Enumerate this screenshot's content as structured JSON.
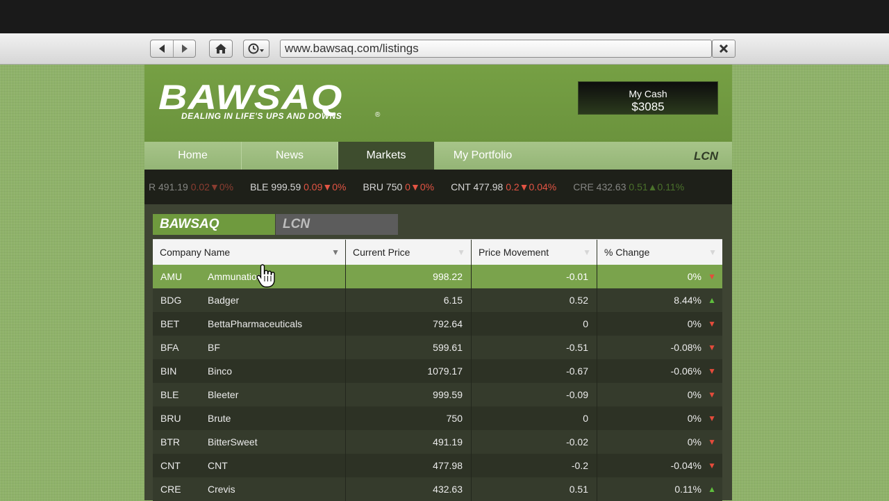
{
  "browser": {
    "url": "www.bawsaq.com/listings",
    "back_icon": "arrow-left-icon",
    "forward_icon": "arrow-right-icon",
    "home_icon": "home-icon",
    "history_icon": "clock-icon",
    "close_icon": "close-icon"
  },
  "header": {
    "logo": "BAWSAQ",
    "tagline": "DEALING IN LIFE'S UPS AND DOWNS",
    "registered": "®",
    "cash_label": "My Cash",
    "cash_value": "$3085"
  },
  "nav": {
    "tabs": [
      {
        "label": "Home"
      },
      {
        "label": "News"
      },
      {
        "label": "Markets",
        "active": true
      },
      {
        "label": "My Portfolio"
      }
    ],
    "lcn_logo": "LCN"
  },
  "ticker": [
    {
      "sym": "R 491.19",
      "chg": "0.02",
      "pct": "0%",
      "dir": "down",
      "faded": true
    },
    {
      "sym": "BLE 999.59",
      "chg": "0.09",
      "pct": "0%",
      "dir": "down"
    },
    {
      "sym": "BRU 750",
      "chg": "0",
      "pct": "0%",
      "dir": "down"
    },
    {
      "sym": "CNT 477.98",
      "chg": "0.2",
      "pct": "0.04%",
      "dir": "down"
    },
    {
      "sym": "CRE 432.63",
      "chg": "0.51",
      "pct": "0.11%",
      "dir": "up",
      "faded": true
    }
  ],
  "market_tabs": {
    "bawsaq": "BAWSAQ",
    "lcn": "LCN"
  },
  "table": {
    "headers": [
      "Company Name",
      "Current Price",
      "Price Movement",
      "% Change"
    ],
    "rows": [
      {
        "code": "AMU",
        "name": "Ammunation",
        "price": "998.22",
        "move": "-0.01",
        "pct": "0%",
        "dir": "down",
        "selected": true
      },
      {
        "code": "BDG",
        "name": "Badger",
        "price": "6.15",
        "move": "0.52",
        "pct": "8.44%",
        "dir": "up"
      },
      {
        "code": "BET",
        "name": "BettaPharmaceuticals",
        "price": "792.64",
        "move": "0",
        "pct": "0%",
        "dir": "down"
      },
      {
        "code": "BFA",
        "name": "BF",
        "price": "599.61",
        "move": "-0.51",
        "pct": "-0.08%",
        "dir": "down"
      },
      {
        "code": "BIN",
        "name": "Binco",
        "price": "1079.17",
        "move": "-0.67",
        "pct": "-0.06%",
        "dir": "down"
      },
      {
        "code": "BLE",
        "name": "Bleeter",
        "price": "999.59",
        "move": "-0.09",
        "pct": "0%",
        "dir": "down"
      },
      {
        "code": "BRU",
        "name": "Brute",
        "price": "750",
        "move": "0",
        "pct": "0%",
        "dir": "down"
      },
      {
        "code": "BTR",
        "name": "BitterSweet",
        "price": "491.19",
        "move": "-0.02",
        "pct": "0%",
        "dir": "down"
      },
      {
        "code": "CNT",
        "name": "CNT",
        "price": "477.98",
        "move": "-0.2",
        "pct": "-0.04%",
        "dir": "down"
      },
      {
        "code": "CRE",
        "name": "Crevis",
        "price": "432.63",
        "move": "0.51",
        "pct": "0.11%",
        "dir": "up"
      }
    ]
  },
  "colors": {
    "accent_green": "#76a044",
    "selected_row": "#7aa34c",
    "down_red": "#e54b3b",
    "up_green": "#5fbf3d"
  }
}
